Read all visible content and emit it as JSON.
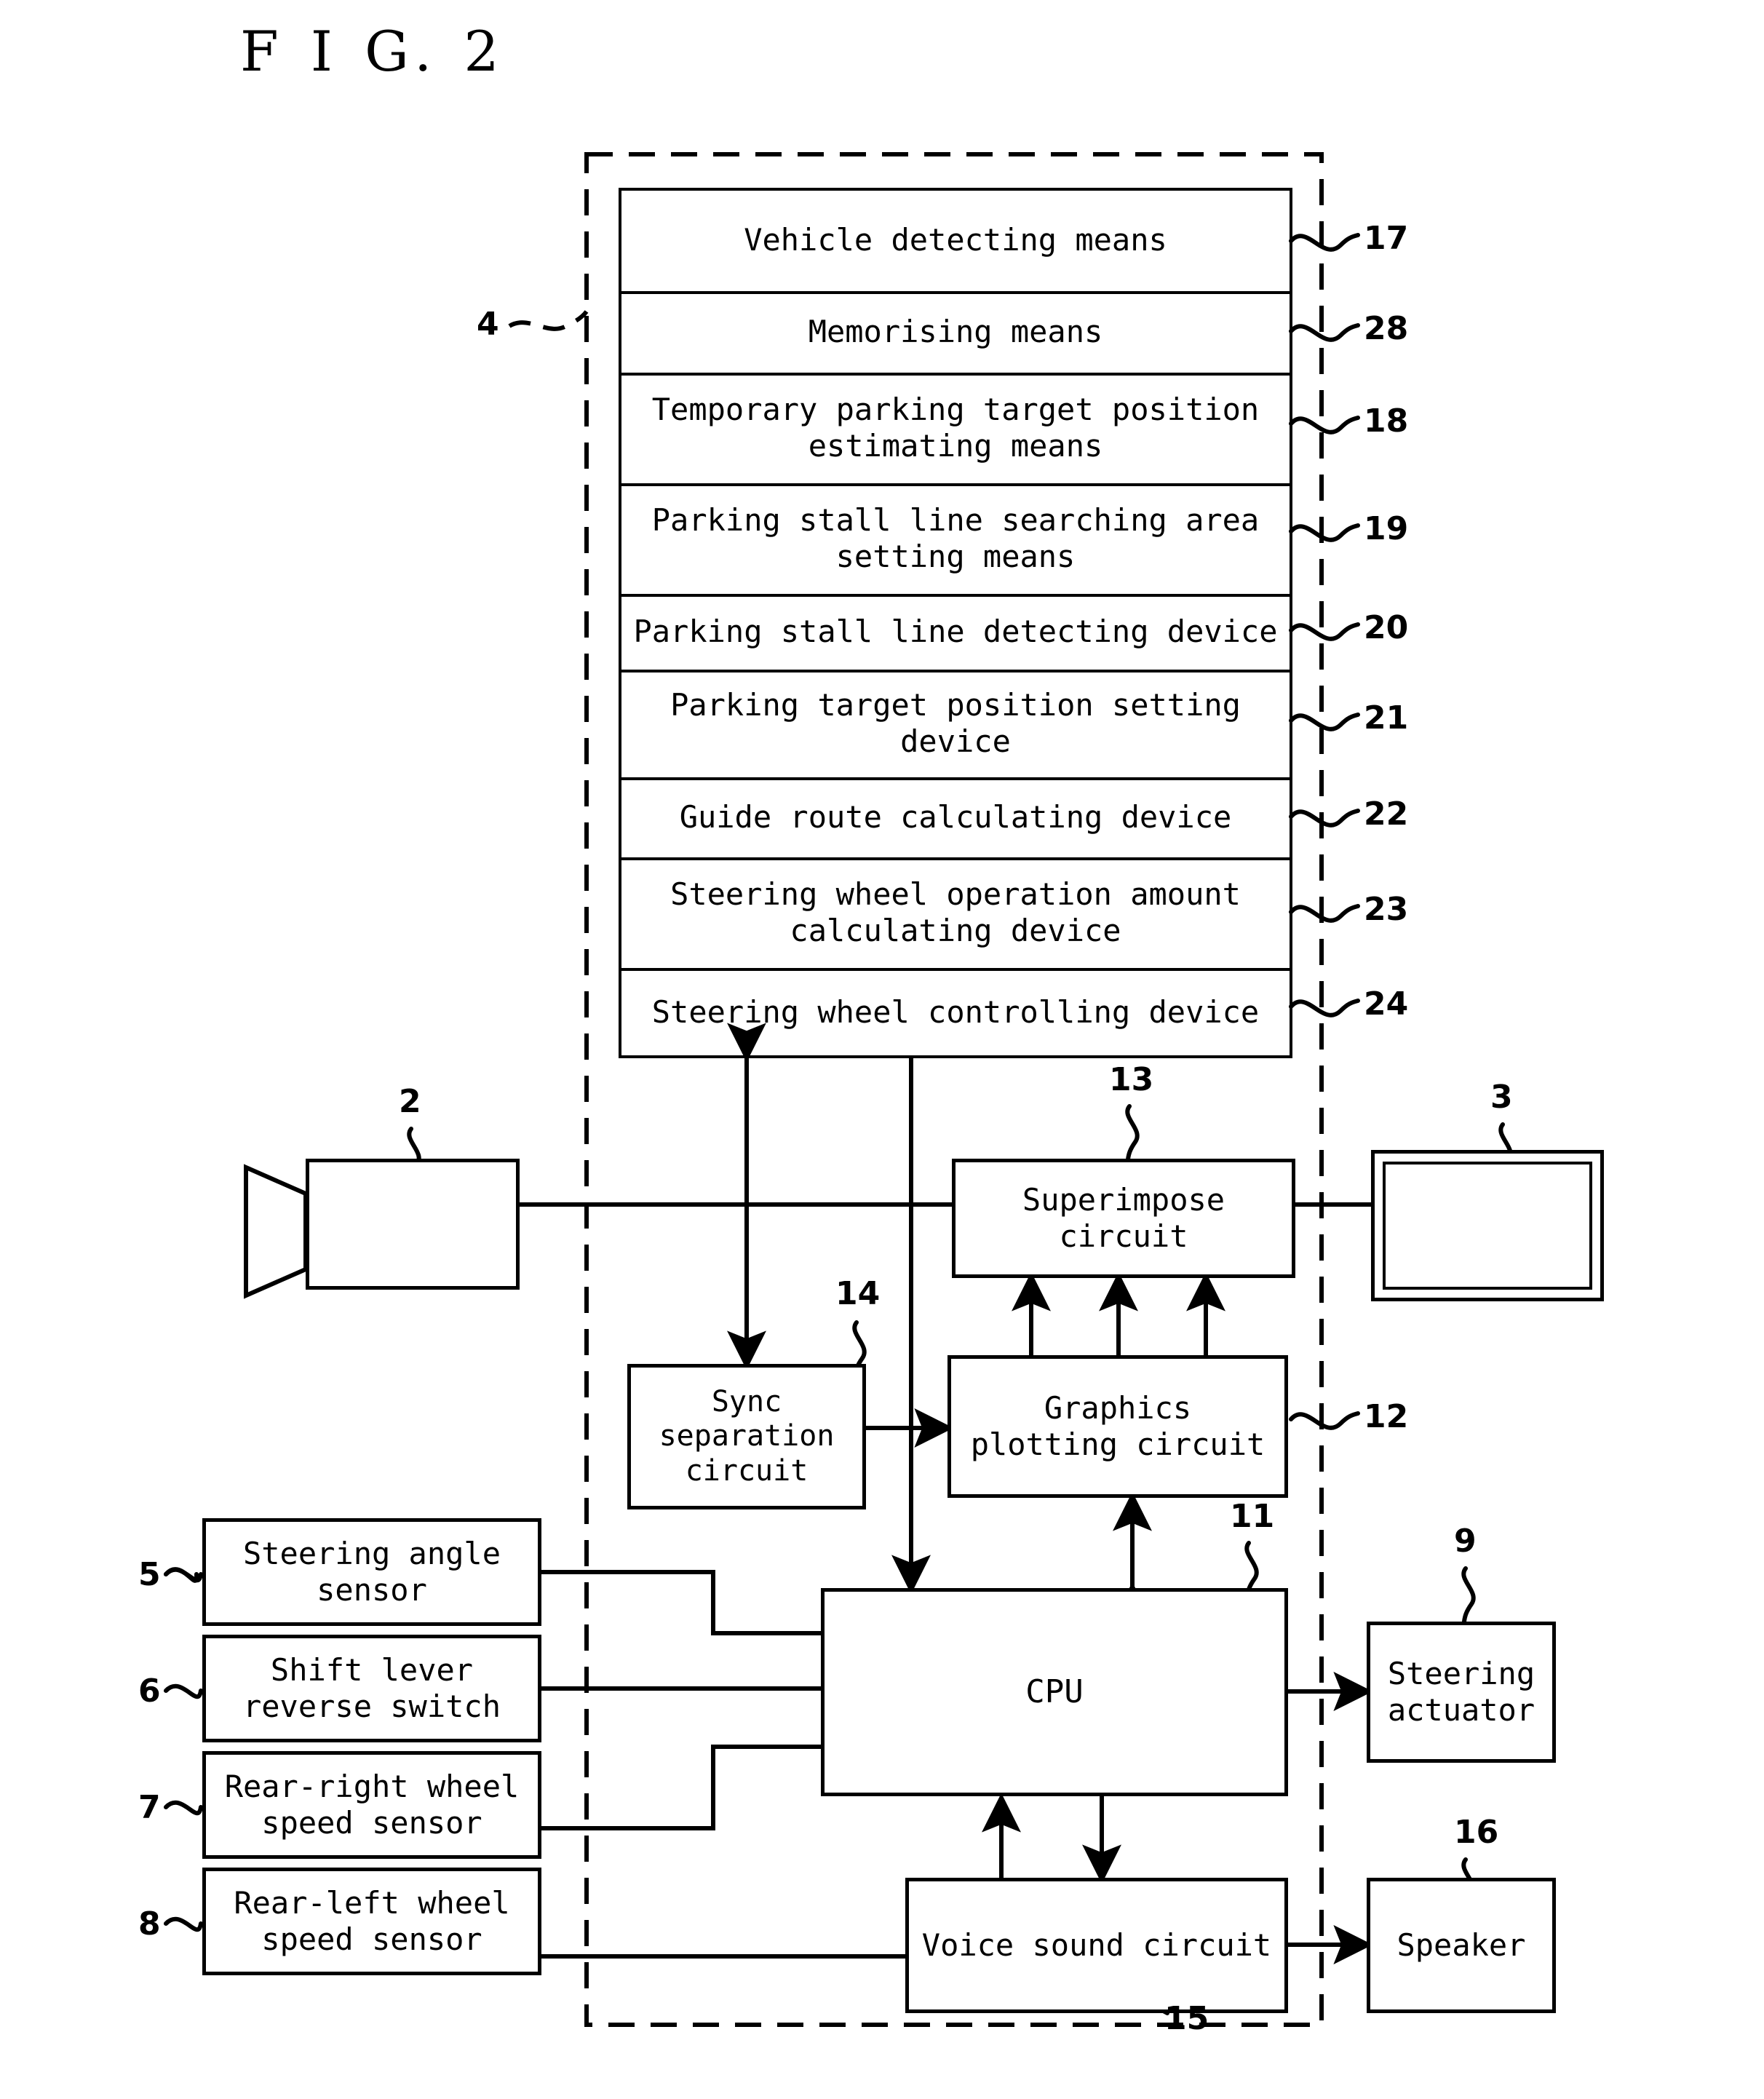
{
  "figure": {
    "title": "F I G. 2",
    "enclosure_ref": "4"
  },
  "ecu_stack": {
    "items": [
      {
        "label": "Vehicle detecting means",
        "ref": "17"
      },
      {
        "label": "Memorising means",
        "ref": "28"
      },
      {
        "label": "Temporary parking target position estimating means",
        "ref": "18"
      },
      {
        "label": "Parking stall line searching area setting means",
        "ref": "19"
      },
      {
        "label": "Parking stall line detecting device",
        "ref": "20"
      },
      {
        "label": "Parking target position setting device",
        "ref": "21"
      },
      {
        "label": "Guide route calculating device",
        "ref": "22"
      },
      {
        "label": "Steering wheel operation amount calculating device",
        "ref": "23"
      },
      {
        "label": "Steering wheel controlling device",
        "ref": "24"
      }
    ]
  },
  "devices": {
    "camera": {
      "label": "",
      "ref": "2"
    },
    "monitor": {
      "label": "",
      "ref": "3"
    },
    "superimpose": {
      "label": "Superimpose circuit",
      "ref": "13"
    },
    "sync_separation": {
      "label": "Sync separation circuit",
      "ref": "14"
    },
    "graphics_plotting": {
      "label": "Graphics plotting circuit",
      "ref": "12"
    },
    "cpu": {
      "label": "CPU",
      "ref": "11"
    },
    "voice_sound": {
      "label": "Voice sound circuit",
      "ref": "15"
    },
    "steering_actuator": {
      "label": "Steering actuator",
      "ref": "9"
    },
    "speaker": {
      "label": "Speaker",
      "ref": "16"
    }
  },
  "sensors": [
    {
      "label": "Steering angle sensor",
      "ref": "5"
    },
    {
      "label": "Shift lever reverse switch",
      "ref": "6"
    },
    {
      "label": "Rear-right wheel speed sensor",
      "ref": "7"
    },
    {
      "label": "Rear-left wheel speed sensor",
      "ref": "8"
    }
  ],
  "colors": {
    "ink": "#000000",
    "paper": "#ffffff"
  }
}
